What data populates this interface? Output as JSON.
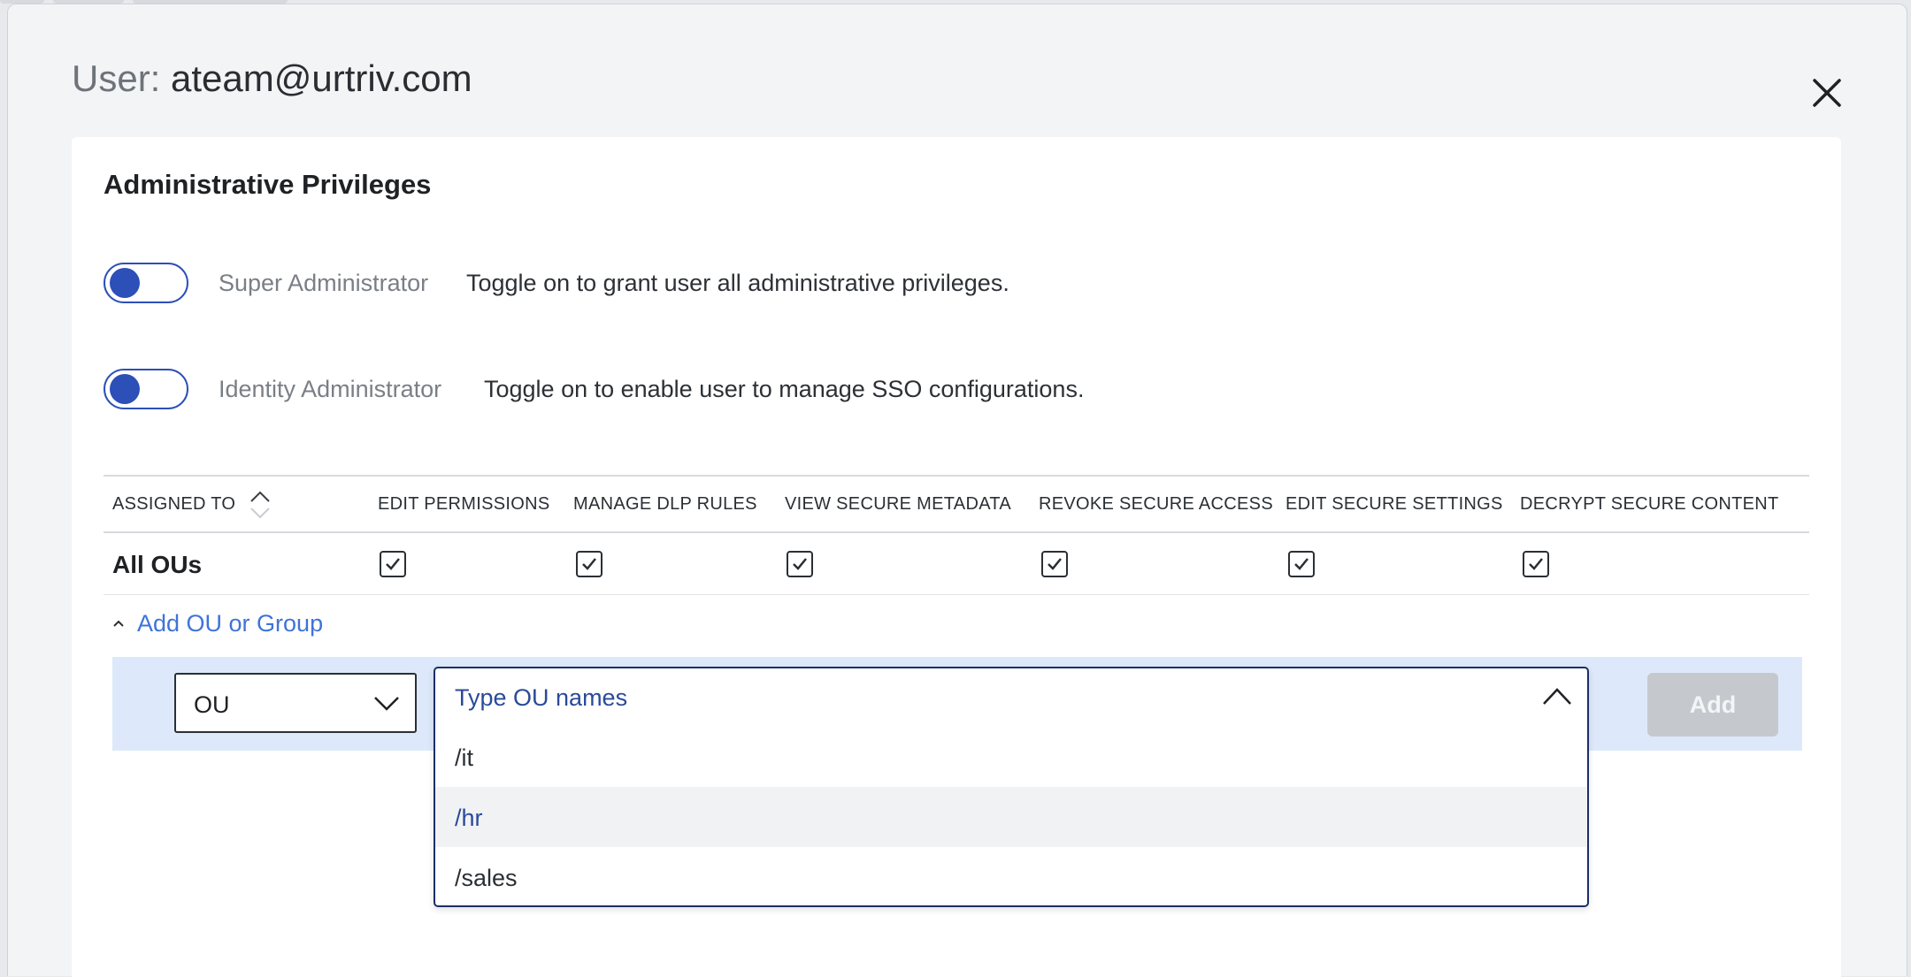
{
  "modal": {
    "title_prefix": "User:",
    "title_user": "ateam@urtriv.com"
  },
  "section": {
    "title": "Administrative Privileges"
  },
  "privileges": [
    {
      "name": "Super Administrator",
      "description": "Toggle on to grant user all administrative privileges.",
      "enabled": false
    },
    {
      "name": "Identity Administrator",
      "description": "Toggle on to enable user to manage SSO configurations.",
      "enabled": false
    }
  ],
  "table": {
    "headers": [
      "ASSIGNED TO",
      "EDIT PERMISSIONS",
      "MANAGE DLP RULES",
      "VIEW SECURE METADATA",
      "REVOKE SECURE ACCESS",
      "EDIT SECURE SETTINGS",
      "DECRYPT SECURE CONTENT"
    ],
    "rows": [
      {
        "assigned_to": "All OUs",
        "checked": [
          true,
          true,
          true,
          true,
          true,
          true
        ]
      }
    ]
  },
  "add_ou": {
    "link_label": "Add OU or Group",
    "type_value": "OU",
    "search_placeholder": "Type OU names",
    "options": [
      "/it",
      "/hr",
      "/sales"
    ],
    "highlighted_option": "/hr",
    "add_button_label": "Add"
  },
  "colors": {
    "accent": "#2c4fb8",
    "link": "#3f73d8",
    "selection_bg": "#dde9fb",
    "disabled_button": "#c5c9ce"
  },
  "icons": {
    "close": "close-icon",
    "sort": "sort-icon",
    "checkbox": "checkmark-icon",
    "collapse": "chevron-up-icon",
    "dropdown": "chevron-down-icon"
  }
}
